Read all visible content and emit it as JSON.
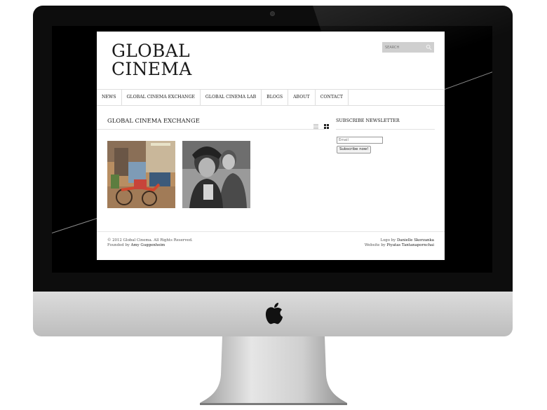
{
  "device": {
    "type": "iMac",
    "logo_icon": "apple-logo-icon"
  },
  "site": {
    "logo_line1": "GLOBAL",
    "logo_line2": "CINEMA",
    "search_placeholder": "SEARCH",
    "nav": [
      "NEWS",
      "GLOBAL CINEMA EXCHANGE",
      "GLOBAL CINEMA LAB",
      "BLOGS",
      "ABOUT",
      "CONTACT"
    ],
    "section_title": "GLOBAL CINEMA EXCHANGE",
    "view_toggles": [
      "list-view-icon",
      "grid-view-icon"
    ],
    "thumbnails": [
      "street-market-photo",
      "children-bw-photo"
    ],
    "newsletter": {
      "title": "SUBSCRIBE NEWSLETTER",
      "email_placeholder": "Email",
      "button_label": "Subscribe now!"
    },
    "footer": {
      "copyright": "© 2012 Global Cinema. All Rights Reserved.",
      "founded_prefix": "Founded by",
      "founded_name": "Amy Guggenheim",
      "logo_prefix": "Logo by",
      "logo_name": "Danielle Skorzanka",
      "website_prefix": "Website by",
      "website_name": "Piyatas Tantanapornchai"
    }
  },
  "colors": {
    "bezel": "#0d0d0d",
    "aluminum": "#c8c8c8",
    "search_bg": "#cfcfcf"
  }
}
